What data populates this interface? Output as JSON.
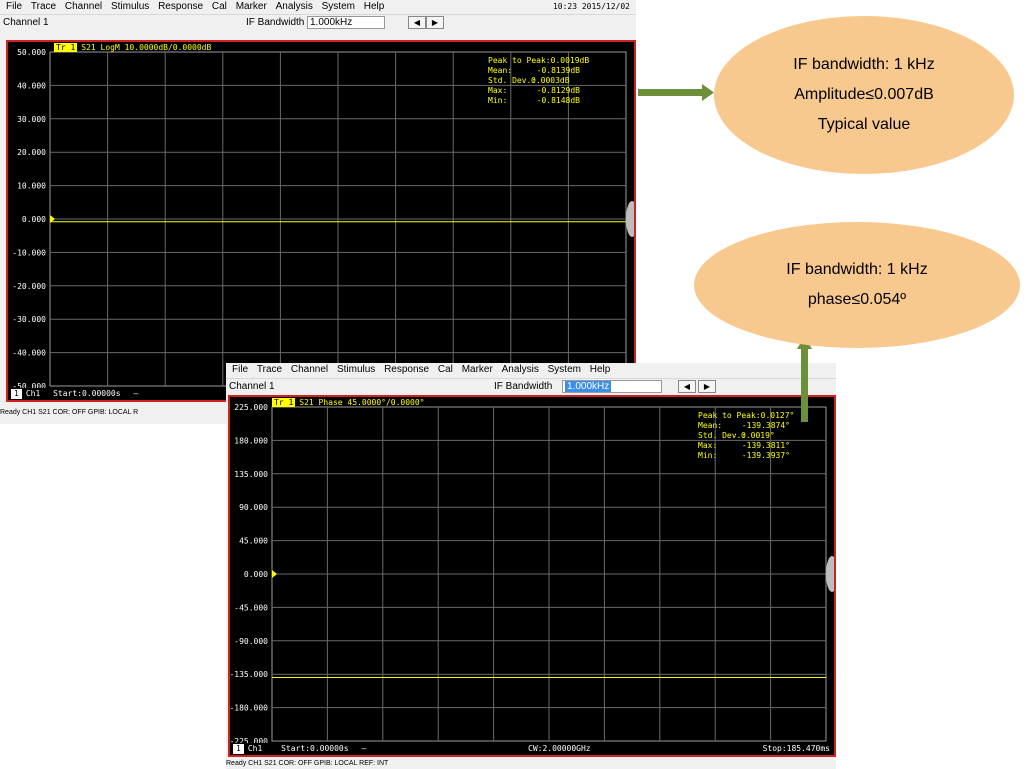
{
  "win1": {
    "menu": [
      "File",
      "Trace",
      "Channel",
      "Stimulus",
      "Response",
      "Cal",
      "Marker",
      "Analysis",
      "System",
      "Help"
    ],
    "clock": "10:23 2015/12/02",
    "channel_label": "Channel 1",
    "if_label": "IF Bandwidth",
    "if_value": "1.000kHz",
    "trace_badge": "Tr 1",
    "trace_label": "S21 LogM 10.0000dB/0.0000dB",
    "y_ticks": [
      "50.000",
      "40.000",
      "30.000",
      "20.000",
      "10.000",
      "0.000",
      "-10.000",
      "-20.000",
      "-30.000",
      "-40.000",
      "-50.000"
    ],
    "stats": {
      "peak_label": "Peak to Peak:",
      "peak_value": "0.0019dB",
      "mean_label": "Mean:",
      "mean_value": "-0.8139dB",
      "std_label": "Std. Dev.:",
      "std_value": "0.0003dB",
      "max_label": "Max:",
      "max_value": "-0.8129dB",
      "min_label": "Min:",
      "min_value": "-0.8148dB"
    },
    "footer_ch": "1",
    "footer_ch_label": "Ch1",
    "footer_start": "Start:0.00000s",
    "footer_dash": "—",
    "status": "Ready                 CH1  S21  COR: OFF  GPIB: LOCAL  R"
  },
  "win2": {
    "menu": [
      "File",
      "Trace",
      "Channel",
      "Stimulus",
      "Response",
      "Cal",
      "Marker",
      "Analysis",
      "System",
      "Help"
    ],
    "channel_label": "Channel 1",
    "if_label": "IF Bandwidth",
    "if_value": "1.000kHz",
    "trace_badge": "Tr 1",
    "trace_label": "S21 Phase 45.0000°/0.0000°",
    "y_ticks": [
      "225.000",
      "180.000",
      "135.000",
      "90.000",
      "45.000",
      "0.000",
      "-45.000",
      "-90.000",
      "-135.000",
      "-180.000",
      "-225.000"
    ],
    "stats": {
      "peak_label": "Peak to Peak:",
      "peak_value": "0.0127°",
      "mean_label": "Mean:",
      "mean_value": "-139.3874°",
      "std_label": "Std. Dev.:",
      "std_value": "0.0019°",
      "max_label": "Max:",
      "max_value": "-139.3811°",
      "min_label": "Min:",
      "min_value": "-139.3937°"
    },
    "footer_ch": "1",
    "footer_ch_label": "Ch1",
    "footer_start": "Start:0.00000s",
    "footer_dash": "—",
    "footer_cw": "CW:2.00000GHz",
    "footer_stop": "Stop:185.470ms",
    "status": "Ready                 CH1  S21  COR: OFF  GPIB: LOCAL  REF: INT"
  },
  "callout1": {
    "line1": "IF bandwidth: 1 kHz",
    "line2": "Amplitude≤0.007dB",
    "line3": "Typical value"
  },
  "callout2": {
    "line1": "IF bandwidth: 1 kHz",
    "line2": "phase≤0.054º"
  },
  "colors": {
    "arrow": "#6e8f3a",
    "callout": "#f8c98f",
    "trace": "#ffff00",
    "frame": "#d02020"
  },
  "chart_data": [
    {
      "type": "line",
      "title": "S21 LogM 10.0000dB/0.0000dB",
      "ylim": [
        -50,
        50
      ],
      "series": [
        {
          "name": "S21",
          "values": [
            -0.8139
          ]
        }
      ]
    },
    {
      "type": "line",
      "title": "S21 Phase 45.0000°/0.0000°",
      "ylim": [
        -225,
        225
      ],
      "series": [
        {
          "name": "S21",
          "values": [
            -139.3874
          ]
        }
      ]
    }
  ]
}
